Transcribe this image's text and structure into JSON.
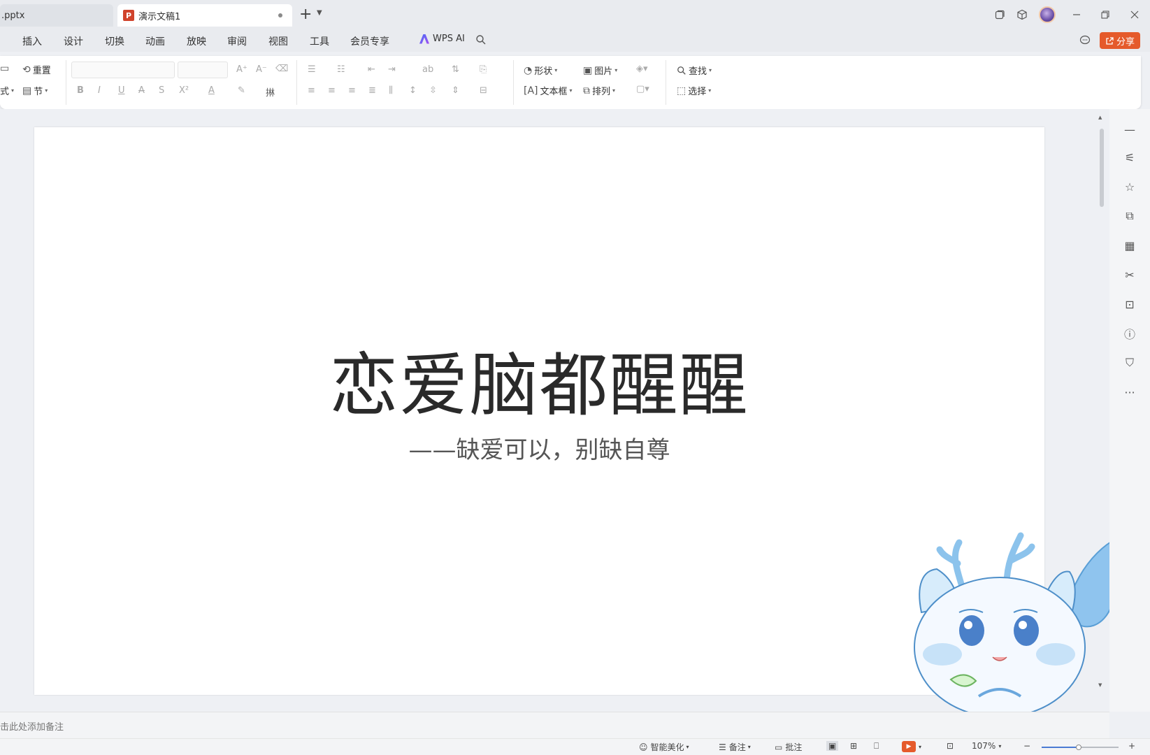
{
  "tabs": [
    {
      "label": ".pptx",
      "active": false
    },
    {
      "label": "演示文稿1",
      "active": true,
      "badge": "P"
    }
  ],
  "menu": [
    "插入",
    "设计",
    "切换",
    "动画",
    "放映",
    "审阅",
    "视图",
    "工具",
    "会员专享"
  ],
  "wps_ai": "WPS AI",
  "share": "分享",
  "ribbon": {
    "reset": "重置",
    "section": "节",
    "shape": "形状",
    "picture": "图片",
    "textbox": "文本框",
    "arrange": "排列",
    "find": "查找",
    "select": "选择"
  },
  "slide": {
    "title": "恋爱脑都醒醒",
    "subtitle": "——缺爱可以，别缺自尊"
  },
  "notes_placeholder": "击此处添加备注",
  "status": {
    "beautify": "智能美化",
    "notes": "备注",
    "comment": "批注",
    "zoom": "107%",
    "zoom_fraction": 0.48
  },
  "colors": {
    "share_bg": "#e55a2b",
    "ppt_badge": "#d0432c",
    "play": "#e55a2b"
  }
}
